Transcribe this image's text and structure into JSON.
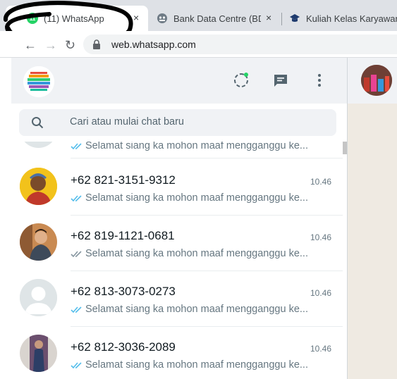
{
  "browser": {
    "tabs": [
      {
        "label": "(11) WhatsApp",
        "favicon": "whatsapp-icon",
        "badge": "11",
        "active": true
      },
      {
        "label": "Bank Data Centre (BDC)",
        "favicon": "bdc-icon",
        "active": false
      },
      {
        "label": "Kuliah Kelas Karyawan",
        "favicon": "graduation-cap-icon",
        "active": false
      }
    ],
    "close_glyph": "×",
    "url": "web.whatsapp.com"
  },
  "whatsapp": {
    "header_icons": [
      "status-icon",
      "new-chat-icon",
      "menu-icon"
    ],
    "status_dot_color": "#25d366",
    "search": {
      "placeholder": "Cari atau mulai chat baru"
    },
    "chats": [
      {
        "name": "",
        "time": "",
        "preview": "Selamat siang ka mohon maaf mengganggu ke...",
        "ticks_color": "#53bdeb"
      },
      {
        "name": "+62 821-3151-9312",
        "time": "10.46",
        "preview": "Selamat siang ka mohon maaf mengganggu ke...",
        "ticks_color": "#53bdeb"
      },
      {
        "name": "+62 819-1121-0681",
        "time": "10.46",
        "preview": "Selamat siang ka mohon maaf mengganggu ke...",
        "ticks_color": "#8696a0"
      },
      {
        "name": "+62 813-3073-0273",
        "time": "10.46",
        "preview": "Selamat siang ka mohon maaf mengganggu ke...",
        "ticks_color": "#53bdeb"
      },
      {
        "name": "+62 812-3036-2089",
        "time": "10.46",
        "preview": "Selamat siang ka mohon maaf mengganggu ke...",
        "ticks_color": "#53bdeb"
      }
    ]
  },
  "colors": {
    "accent": "#25d366",
    "read_ticks": "#53bdeb",
    "delivered_ticks": "#8696a0",
    "panel": "#f0f2f5"
  }
}
